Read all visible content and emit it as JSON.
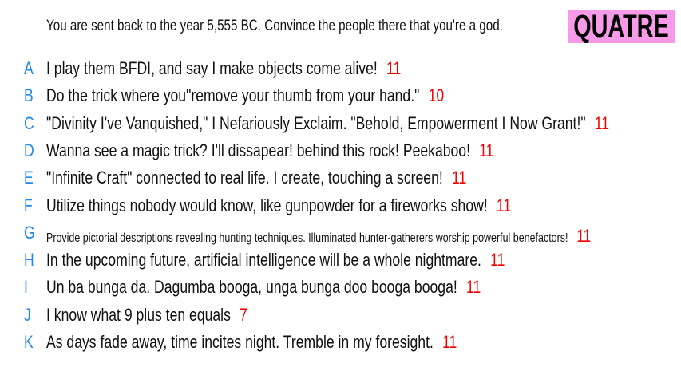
{
  "prompt": "You are sent back to the year 5,555 BC. Convince the people there that you're a god.",
  "tag": {
    "label": "QUATRE",
    "color": "#f79ae8"
  },
  "answers": [
    {
      "letter": "A",
      "text": "I play them BFDI, and say I make objects come alive!",
      "score": "11"
    },
    {
      "letter": "B",
      "text": "Do the trick where you\"remove your thumb from your hand.\"",
      "score": "10"
    },
    {
      "letter": "C",
      "text": "\"Divinity I've Vanquished,\" I Nefariously Exclaim. \"Behold, Empowerment I Now Grant!\"",
      "score": "11"
    },
    {
      "letter": "D",
      "text": "Wanna see a magic trick? I'll dissapear! behind this rock! Peekaboo!",
      "score": "11"
    },
    {
      "letter": "E",
      "text": "\"Infinite Craft\" connected to real life. I create, touching a screen!",
      "score": "11"
    },
    {
      "letter": "F",
      "text": "Utilize things nobody would know, like gunpowder for a fireworks show!",
      "score": "11"
    },
    {
      "letter": "G",
      "text": "Provide pictorial descriptions revealing hunting techniques. Illuminated hunter-gatherers worship powerful benefactors!",
      "score": "11"
    },
    {
      "letter": "H",
      "text": "In the upcoming future, artificial intelligence will be a whole nightmare.",
      "score": "11"
    },
    {
      "letter": "I",
      "text": "Un ba bunga da. Dagumba booga, unga bunga doo booga booga!",
      "score": "11"
    },
    {
      "letter": "J",
      "text": "I know what 9 plus ten equals",
      "score": "7"
    },
    {
      "letter": "K",
      "text": "As days fade away, time incites night. Tremble in my foresight.",
      "score": "11"
    }
  ]
}
